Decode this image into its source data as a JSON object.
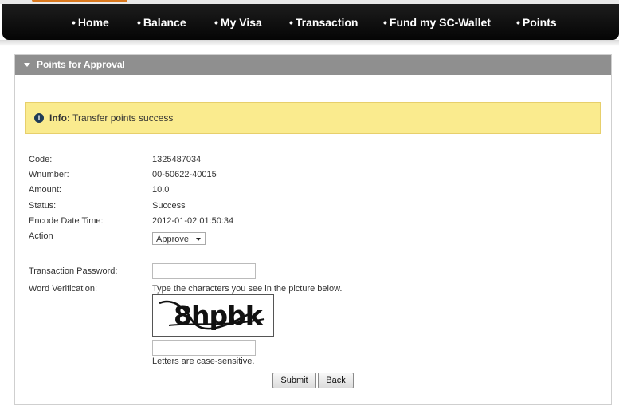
{
  "nav": {
    "bullet": "•",
    "items": [
      {
        "label": "Home"
      },
      {
        "label": "Balance"
      },
      {
        "label": "My Visa"
      },
      {
        "label": "Transaction"
      },
      {
        "label": "Fund my SC-Wallet"
      },
      {
        "label": "Points"
      }
    ]
  },
  "panel": {
    "title": "Points for Approval"
  },
  "info": {
    "icon_glyph": "i",
    "prefix": "Info:",
    "message": "Transfer points success"
  },
  "details": {
    "code_label": "Code:",
    "code_value": "1325487034",
    "wnumber_label": "Wnumber:",
    "wnumber_value": "00-50622-40015",
    "amount_label": "Amount:",
    "amount_value": "10.0",
    "status_label": "Status:",
    "status_value": "Success",
    "encode_label": "Encode Date Time:",
    "encode_value": "2012-01-02 01:50:34",
    "action_label": "Action",
    "action_selected": "Approve"
  },
  "form": {
    "password_label": "Transaction Password:",
    "password_value": "",
    "verification_label": "Word Verification:",
    "verification_instruction": "Type the characters you see in the picture below.",
    "captcha_text": "8hpbk",
    "verification_value": "",
    "case_note": "Letters are case-sensitive.",
    "submit_label": "Submit",
    "back_label": "Back"
  }
}
